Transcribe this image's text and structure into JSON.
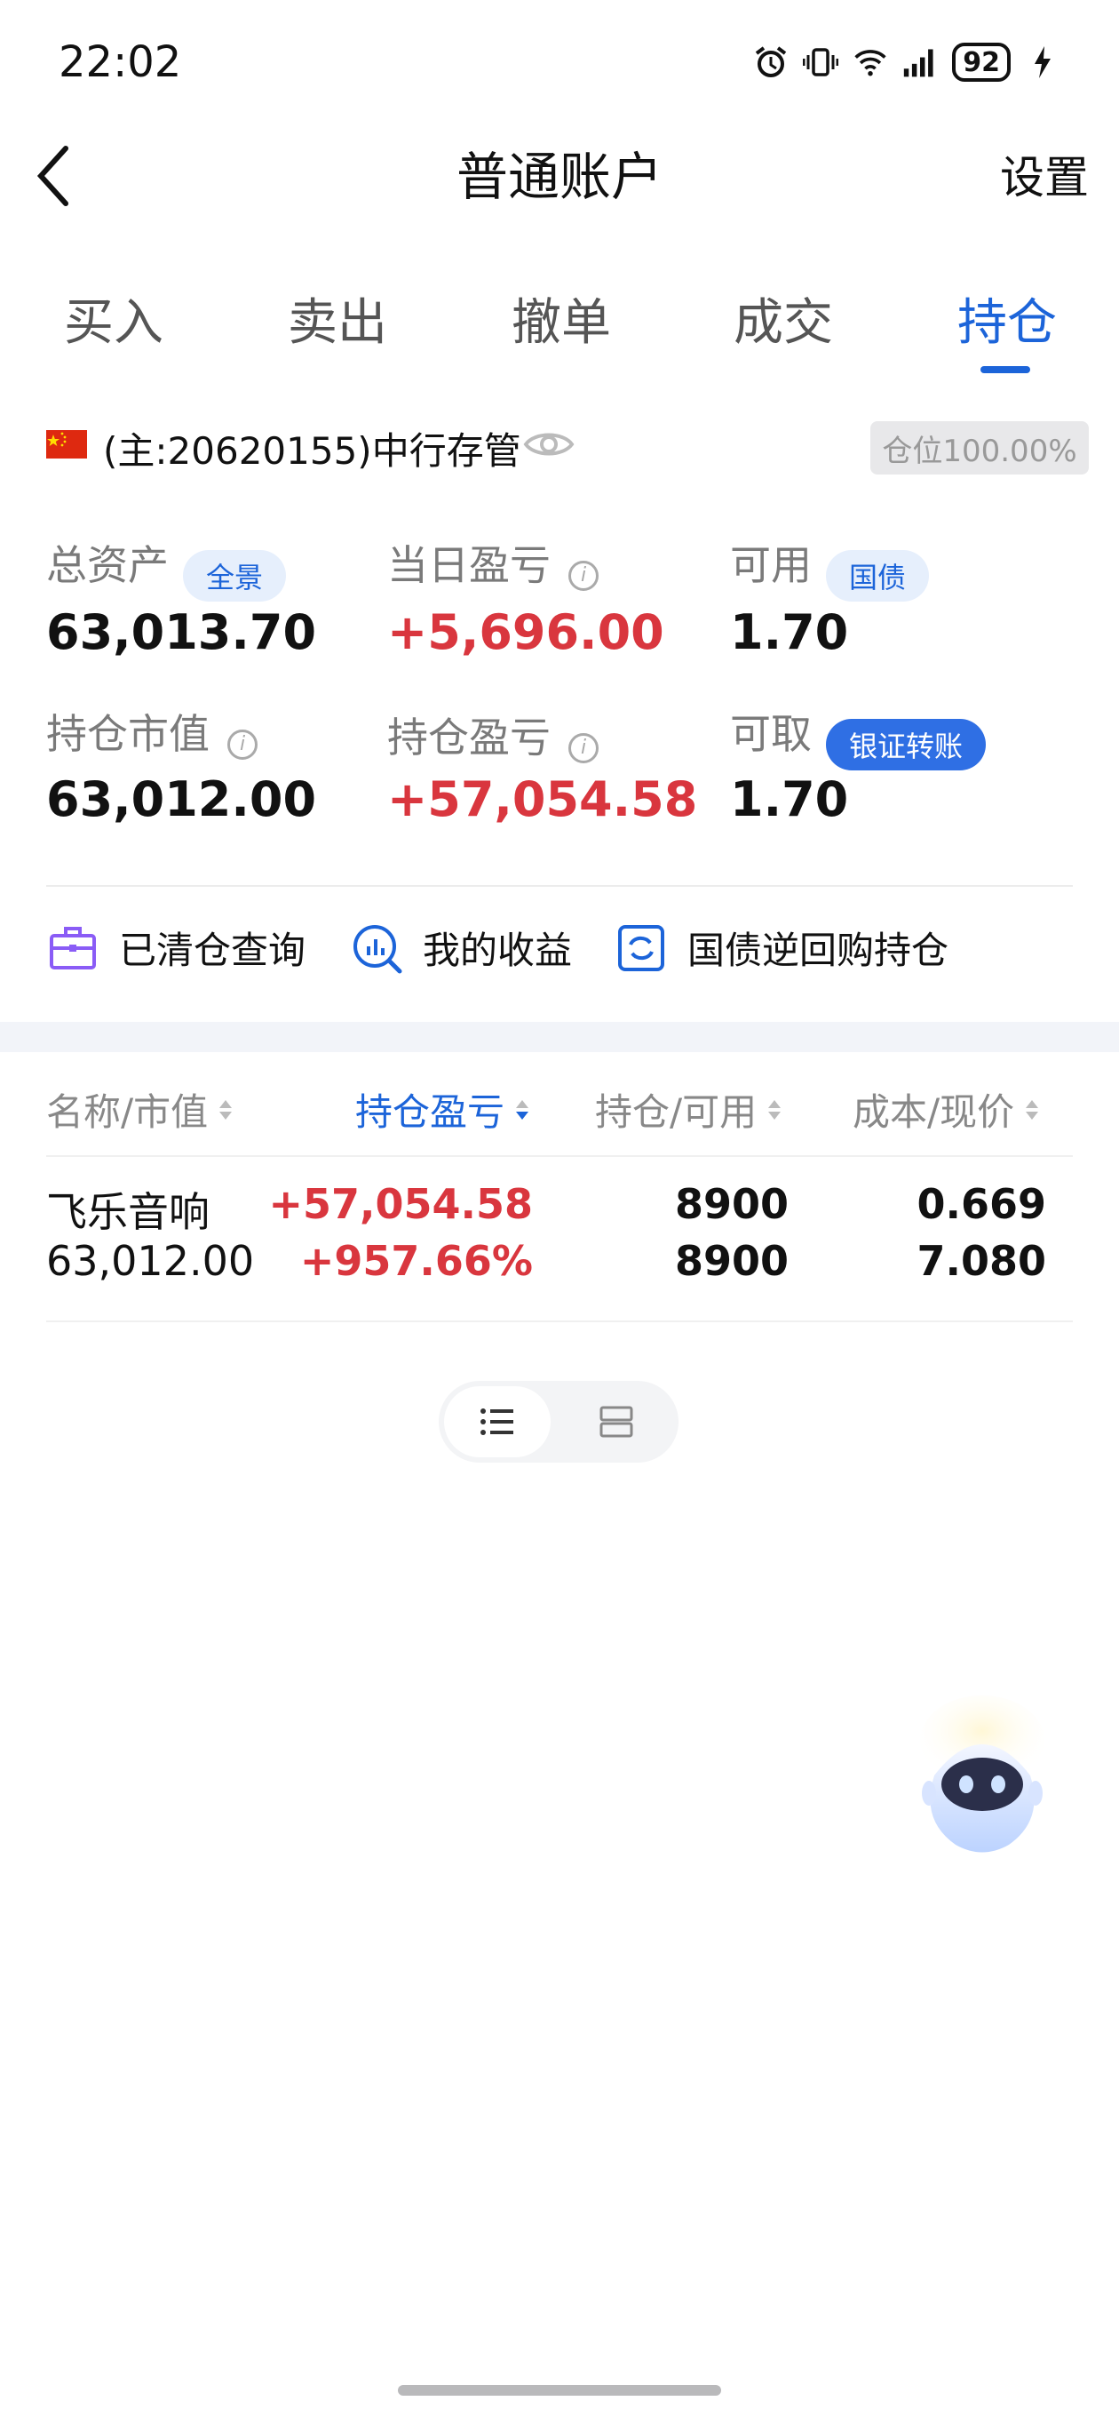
{
  "status_bar": {
    "time": "22:02",
    "battery": "92"
  },
  "header": {
    "title": "普通账户",
    "settings_label": "设置"
  },
  "tabs": [
    {
      "label": "买入"
    },
    {
      "label": "卖出"
    },
    {
      "label": "撤单"
    },
    {
      "label": "成交"
    },
    {
      "label": "持仓",
      "active": true
    }
  ],
  "account": {
    "label": "(主:20620155)中行存管",
    "position_badge": "仓位100.00%"
  },
  "summary": {
    "total_assets": {
      "label": "总资产",
      "badge": "全景",
      "value": "63,013.70"
    },
    "daily_pnl": {
      "label": "当日盈亏",
      "value": "+5,696.00"
    },
    "available": {
      "label": "可用",
      "badge": "国债",
      "value": "1.70"
    },
    "market_value": {
      "label": "持仓市值",
      "value": "63,012.00"
    },
    "position_pnl": {
      "label": "持仓盈亏",
      "value": "+57,054.58"
    },
    "withdrawable": {
      "label": "可取",
      "badge": "银证转账",
      "value": "1.70"
    }
  },
  "quick_links": [
    {
      "label": "已清仓查询",
      "icon": "briefcase-icon"
    },
    {
      "label": "我的收益",
      "icon": "chart-search-icon"
    },
    {
      "label": "国债逆回购持仓",
      "icon": "exchange-icon"
    }
  ],
  "table": {
    "headers": [
      "名称/市值",
      "持仓盈亏",
      "持仓/可用",
      "成本/现价"
    ],
    "rows": [
      {
        "name": "飞乐音响",
        "market_value": "63,012.00",
        "pnl": "+57,054.58",
        "pnl_pct": "+957.66%",
        "position": "8900",
        "available": "8900",
        "cost": "0.669",
        "price": "7.080"
      }
    ]
  },
  "colors": {
    "accent": "#1c64d9",
    "profit": "#d9363e"
  }
}
